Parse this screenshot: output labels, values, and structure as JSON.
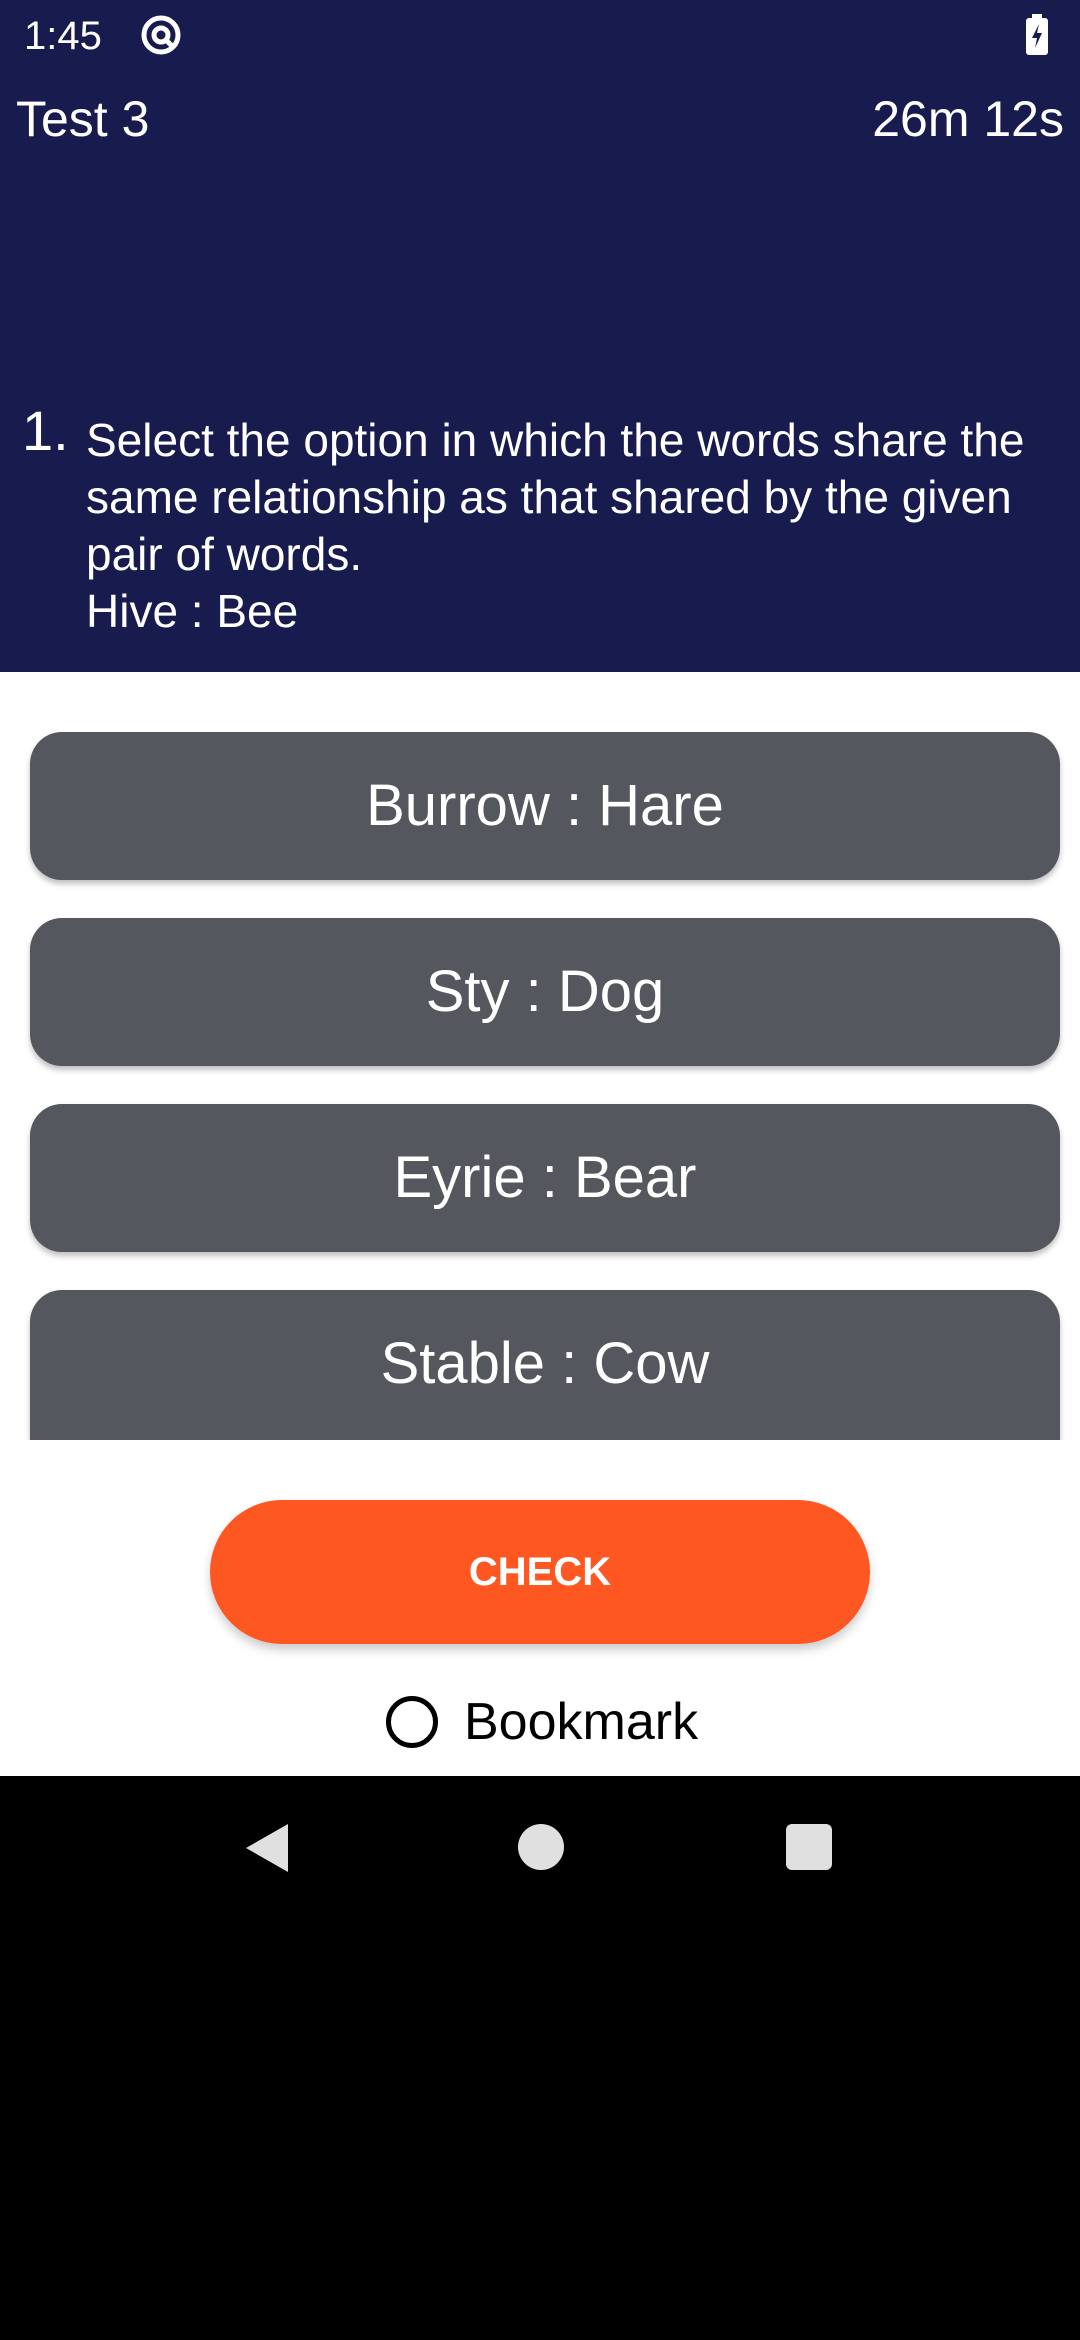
{
  "status_bar": {
    "time": "1:45",
    "app_icon": "at-sign-icon",
    "battery_icon": "battery-charging-icon"
  },
  "header": {
    "test_title": "Test 3",
    "timer": "26m 12s"
  },
  "question": {
    "number": "1.",
    "text": "Select the option in which the words share the same relationship as that shared by the given pair of words.",
    "pair": "Hive : Bee"
  },
  "options": [
    {
      "label": "Burrow : Hare"
    },
    {
      "label": "Sty : Dog"
    },
    {
      "label": "Eyrie : Bear"
    },
    {
      "label": "Stable : Cow"
    }
  ],
  "actions": {
    "check_label": "CHECK",
    "bookmark_label": "Bookmark"
  },
  "nav": {
    "back_icon": "back-triangle-icon",
    "home_icon": "home-circle-icon",
    "recents_icon": "recents-square-icon"
  },
  "colors": {
    "header_bg": "#171b4e",
    "option_bg": "#54575e",
    "check_bg": "#ff5722"
  }
}
